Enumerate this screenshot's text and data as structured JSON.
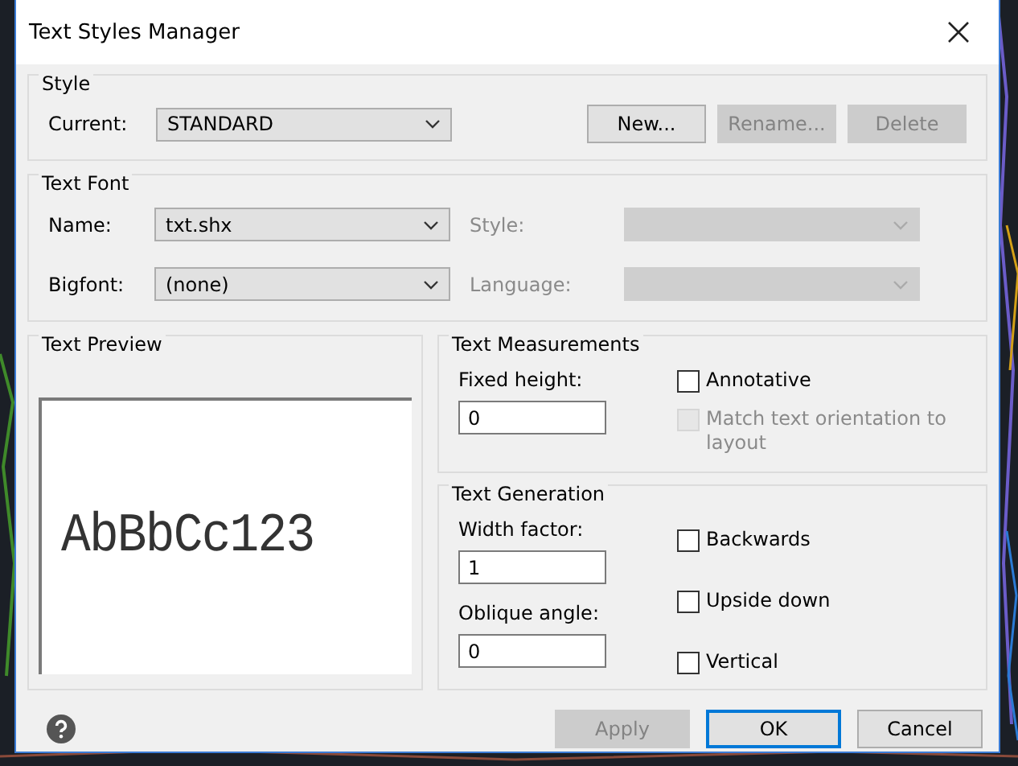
{
  "window": {
    "title": "Text Styles Manager"
  },
  "style_group": {
    "title": "Style",
    "current": {
      "label": "Current:",
      "value": "STANDARD"
    },
    "buttons": [
      {
        "label": "New...",
        "disabled": false
      },
      {
        "label": "Rename...",
        "disabled": true
      },
      {
        "label": "Delete",
        "disabled": true
      }
    ]
  },
  "text_font": {
    "title": "Text Font",
    "fields": [
      {
        "label": "Name:",
        "value": "txt.shx",
        "disabled": false
      },
      {
        "label": "Style:",
        "disabled": true
      },
      {
        "label": "Bigfont:",
        "value": "(none)",
        "disabled": false
      },
      {
        "label": "Language:",
        "disabled": true
      }
    ]
  },
  "preview": {
    "title": "Text Preview",
    "sample": "AbBbCc123"
  },
  "measurements": {
    "title": "Text Measurements",
    "fixed_height": {
      "label": "Fixed height:",
      "value": "0"
    },
    "options": [
      {
        "label": "Annotative",
        "checked": false,
        "disabled": false
      },
      {
        "label": "Match text orientation to layout",
        "checked": false,
        "disabled": true
      }
    ]
  },
  "generation": {
    "title": "Text Generation",
    "fields": [
      {
        "label": "Width factor:",
        "value": "1"
      },
      {
        "label": "Oblique angle:",
        "value": "0"
      }
    ],
    "options": [
      {
        "label": "Backwards",
        "checked": false,
        "disabled": false
      },
      {
        "label": "Upside down",
        "checked": false,
        "disabled": false
      },
      {
        "label": "Vertical",
        "checked": false,
        "disabled": false
      }
    ]
  },
  "footer": {
    "buttons": [
      {
        "label": "Apply",
        "disabled": true,
        "default": false
      },
      {
        "label": "OK",
        "disabled": false,
        "default": true
      },
      {
        "label": "Cancel",
        "disabled": false,
        "default": false
      }
    ]
  }
}
